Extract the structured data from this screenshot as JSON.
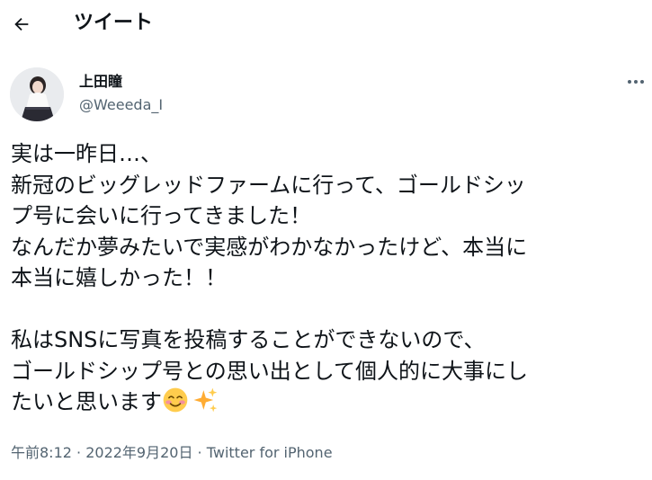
{
  "header": {
    "title": "ツイート",
    "back_icon": "arrow-left-icon"
  },
  "author": {
    "display_name": "上田瞳",
    "handle": "@Weeeda_I",
    "more_icon": "more-horizontal-icon"
  },
  "tweet": {
    "lines": [
      "実は一昨日…、",
      "新冠のビッグレッドファームに行って、ゴールドシッ",
      "プ号に会いに行ってきました！",
      "なんだか夢みたいで実感がわかなかったけど、本当に",
      "本当に嬉しかった！！",
      "",
      "私はSNSに写真を投稿することができないので、",
      "ゴールドシップ号との思い出として個人的に大事にし",
      "たいと思います"
    ],
    "emojis": [
      "smiling-face-icon",
      "sparkles-icon"
    ]
  },
  "meta": {
    "time": "午前8:12",
    "separator": " · ",
    "date": "2022年9月20日",
    "source": "Twitter for iPhone"
  },
  "colors": {
    "text": "#0f1419",
    "secondary": "#536471"
  }
}
